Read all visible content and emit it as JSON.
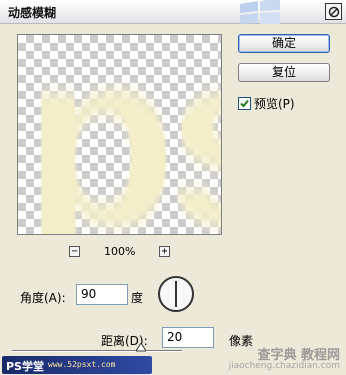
{
  "dialog": {
    "title": "动感模糊"
  },
  "preview": {
    "text": "ps",
    "zoom_out_label": "−",
    "zoom_in_label": "+",
    "zoom_level": "100%"
  },
  "buttons": {
    "ok_label": "确定",
    "reset_label": "复位"
  },
  "preview_toggle": {
    "label": "预览(P)",
    "checked": true
  },
  "angle": {
    "label": "角度(A):",
    "value": "90",
    "unit": "度"
  },
  "distance": {
    "label": "距离(D):",
    "value": "20",
    "unit": "像素"
  },
  "watermarks": {
    "left_text": "PS学堂",
    "left_url": "www.52psxt.com",
    "right_text": "查字典 教程网",
    "right_url": "jiaocheng.chazidian.com"
  },
  "colors": {
    "ps_text": "#f3edc8",
    "dialog_bg": "#ece9d8"
  }
}
